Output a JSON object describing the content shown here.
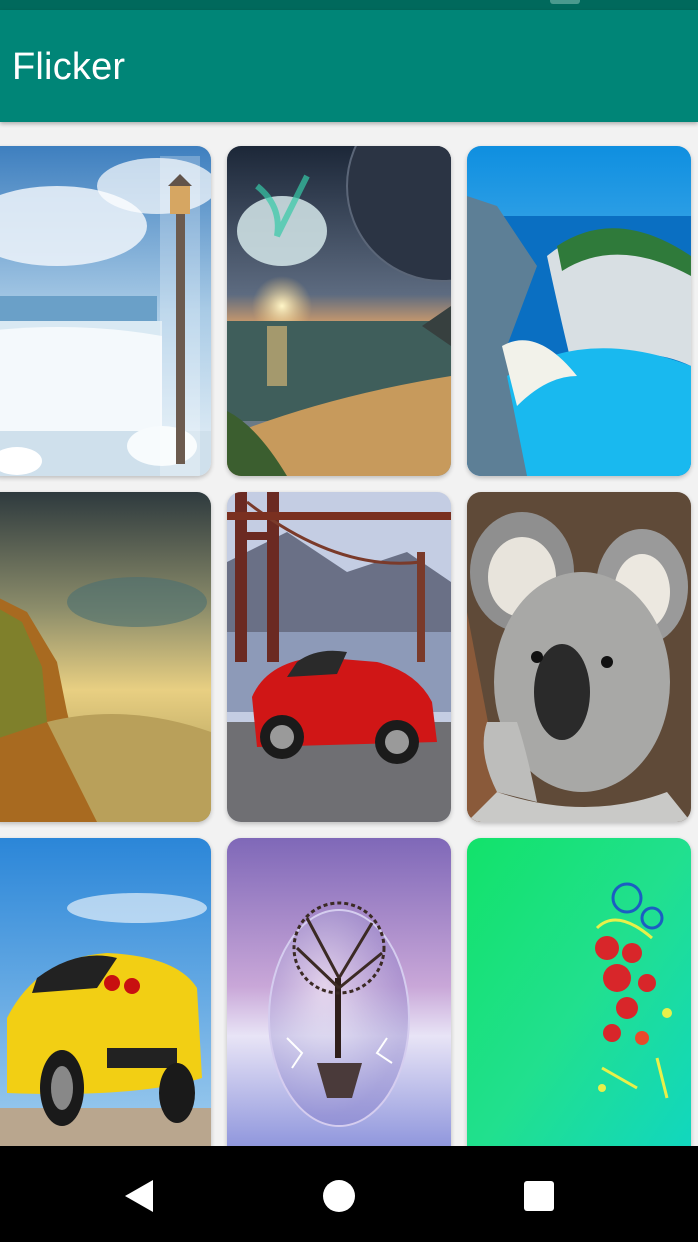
{
  "app_bar": {
    "title": "Flicker"
  },
  "gallery": {
    "images": [
      {
        "name": "waterfall-lamp-image"
      },
      {
        "name": "fantasy-sunset-image"
      },
      {
        "name": "blue-cove-image"
      },
      {
        "name": "golden-cliff-image"
      },
      {
        "name": "red-car-bridge-image"
      },
      {
        "name": "koala-image"
      },
      {
        "name": "yellow-car-image"
      },
      {
        "name": "tree-bubble-image"
      },
      {
        "name": "green-abstract-image"
      }
    ]
  },
  "colors": {
    "primary": "#008577",
    "primary_dark": "#00695c",
    "nav_bar": "#000000"
  },
  "navigation": {
    "icons": [
      "back-icon",
      "home-icon",
      "recents-icon"
    ]
  }
}
